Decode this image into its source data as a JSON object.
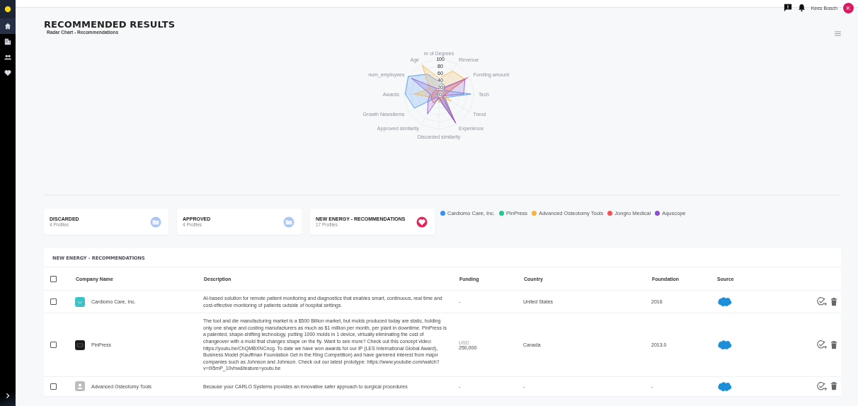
{
  "sidebar": {
    "items": [
      {
        "kind": "logo",
        "selected": false
      },
      {
        "kind": "home",
        "selected": true
      },
      {
        "kind": "buildings",
        "selected": false
      },
      {
        "kind": "people",
        "selected": false
      },
      {
        "kind": "heart",
        "selected": false
      }
    ]
  },
  "header": {
    "user_name": "Kees Bosch",
    "avatar_initial": "K"
  },
  "page": {
    "title": "RECOMMENDED RESULTS",
    "subtitle": "Radar Chart - Recommendations"
  },
  "radar": {
    "top_axis_label": "nr of Degrees",
    "right_axis_labels": [
      "Revenue",
      "Funding amount",
      "Tech",
      "Trend",
      "Experience"
    ],
    "left_axis_labels": [
      "Age",
      "num_employees",
      "Awards",
      "Growth NewsItems",
      "Approved similarity"
    ],
    "bottom_axis_label": "Discarded similarity",
    "tick_labels": [
      "100",
      "80",
      "60",
      "40",
      "20",
      "0"
    ],
    "series": [
      {
        "name": "Cardiomo Care, Inc.",
        "color": "#3b8ff3"
      },
      {
        "name": "PinPress",
        "color": "#22c98c"
      },
      {
        "name": "Advanced Osteotomy Tools",
        "color": "#f5b53c"
      },
      {
        "name": "Jongro Medical",
        "color": "#f2545b"
      },
      {
        "name": "Aquscope",
        "color": "#8a4fd0"
      }
    ]
  },
  "cards": [
    {
      "title": "DISCARDED",
      "count": "4 Profiles",
      "kind": "folder"
    },
    {
      "title": "APPROVED",
      "count": "4 Profiles",
      "kind": "folder"
    },
    {
      "title": "NEW ENERGY - RECOMMENDATIONS",
      "count": "17 Profiles",
      "kind": "heart"
    }
  ],
  "table": {
    "title": "NEW ENERGY - RECOMMENDATIONS",
    "select_all_checked": false,
    "columns": [
      "Company Name",
      "Description",
      "Funding",
      "Country",
      "Foundation",
      "Source"
    ],
    "rows": [
      {
        "checked": false,
        "kind": "teal",
        "company": "Cardiomo Care, Inc.",
        "description": "AI-based solution for remote patient monitoring and diagnostics that enables smart, continuous, real time and cost-effective monitoring of patients outside of hospital settings.",
        "funding": "-",
        "country": "United States",
        "foundation": "2016"
      },
      {
        "checked": false,
        "kind": "dark",
        "company": "PinPress",
        "description": "The tool and die manufacturing market is a $500 Billion market, but molds produced today are static, holding only one shape and costing manufacturers as much as $1 million per month, per plant in downtime. PinPress is a patented, shape-shifting technology, putting 1000 molds in 1 device, virtually eliminating the cost of changeover with a mold that changes shape on the fly. Want to see more? Check out this concept video: https://youtu.be/ChQMBXNCncg. To date we have won awards for our IP (LES International Global Award), Business Model (Kauffman Foundation Get in the Ring Competition) and have garnered interest from major companies such as Johnson and Johnson. Check out our latest prototype: https://www.youtube.com/watch?v=I95mP_10vhw&feature=youtu.be",
        "funding_currency": "USD",
        "funding": "250,000",
        "country": "Canada",
        "foundation": "2013.0"
      },
      {
        "checked": false,
        "kind": "placeholder",
        "company": "Advanced Osteotomy Tools",
        "description": "Because your CARLO Systems provides an innovative safer approach to surgical procedures",
        "funding": "-",
        "country": "-",
        "foundation": "-"
      }
    ]
  }
}
